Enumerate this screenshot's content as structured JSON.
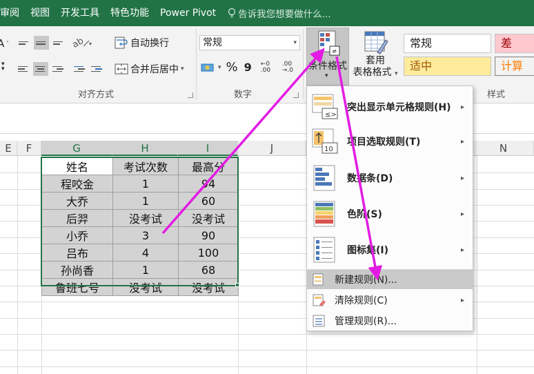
{
  "menubar": {
    "tabs": [
      "审阅",
      "视图",
      "开发工具",
      "特色功能",
      "Power Pivot"
    ],
    "tell_me": "告诉我您想要做什么..."
  },
  "ribbon": {
    "alignment": {
      "wrap_text": "自动换行",
      "merge_center": "合并后居中",
      "group_label": "对齐方式"
    },
    "number": {
      "format_value": "常规",
      "percent": "%",
      "comma": "9",
      "inc_decimal": "←0 .00",
      "dec_decimal": ".00 →.0",
      "group_label": "数字"
    },
    "conditional_format": {
      "label": "条件格式"
    },
    "format_as_table": {
      "label_line1": "套用",
      "label_line2": "表格格式"
    },
    "styles": {
      "cells": [
        "常规",
        "差",
        "适中",
        "计算"
      ],
      "group_label": "样式"
    }
  },
  "grid": {
    "column_headers": [
      "E",
      "F",
      "G",
      "H",
      "I",
      "J",
      "N"
    ],
    "table": {
      "headers": [
        "姓名",
        "考试次数",
        "最高分"
      ],
      "rows": [
        [
          "程咬金",
          "1",
          "94"
        ],
        [
          "大乔",
          "1",
          "60"
        ],
        [
          "后羿",
          "没考试",
          "没考试"
        ],
        [
          "小乔",
          "3",
          "90"
        ],
        [
          "吕布",
          "4",
          "100"
        ],
        [
          "孙尚香",
          "1",
          "68"
        ],
        [
          "鲁班七号",
          "没考试",
          "没考试"
        ]
      ]
    }
  },
  "menu": {
    "items": [
      {
        "label": "突出显示单元格规则(H)",
        "icon": "highlight-rules-icon",
        "submenu": true
      },
      {
        "label": "项目选取规则(T)",
        "icon": "top-bottom-rules-icon",
        "submenu": true
      },
      {
        "label": "数据条(D)",
        "icon": "data-bars-icon",
        "submenu": true
      },
      {
        "label": "色阶(S)",
        "icon": "color-scales-icon",
        "submenu": true
      },
      {
        "label": "图标集(I)",
        "icon": "icon-sets-icon",
        "submenu": true
      },
      {
        "label": "新建规则(N)...",
        "icon": "new-rule-icon",
        "submenu": false
      },
      {
        "label": "清除规则(C)",
        "icon": "clear-rules-icon",
        "submenu": true
      },
      {
        "label": "管理规则(R)...",
        "icon": "manage-rules-icon",
        "submenu": false
      }
    ]
  },
  "colors": {
    "excel_green": "#217346",
    "annotation_arrow": "#e31ce3",
    "bad_fill": "#ffc7ce",
    "bad_text": "#9c0006",
    "neutral_fill": "#ffeb9c",
    "neutral_text": "#9c5700",
    "calc_text": "#fa7d00"
  }
}
